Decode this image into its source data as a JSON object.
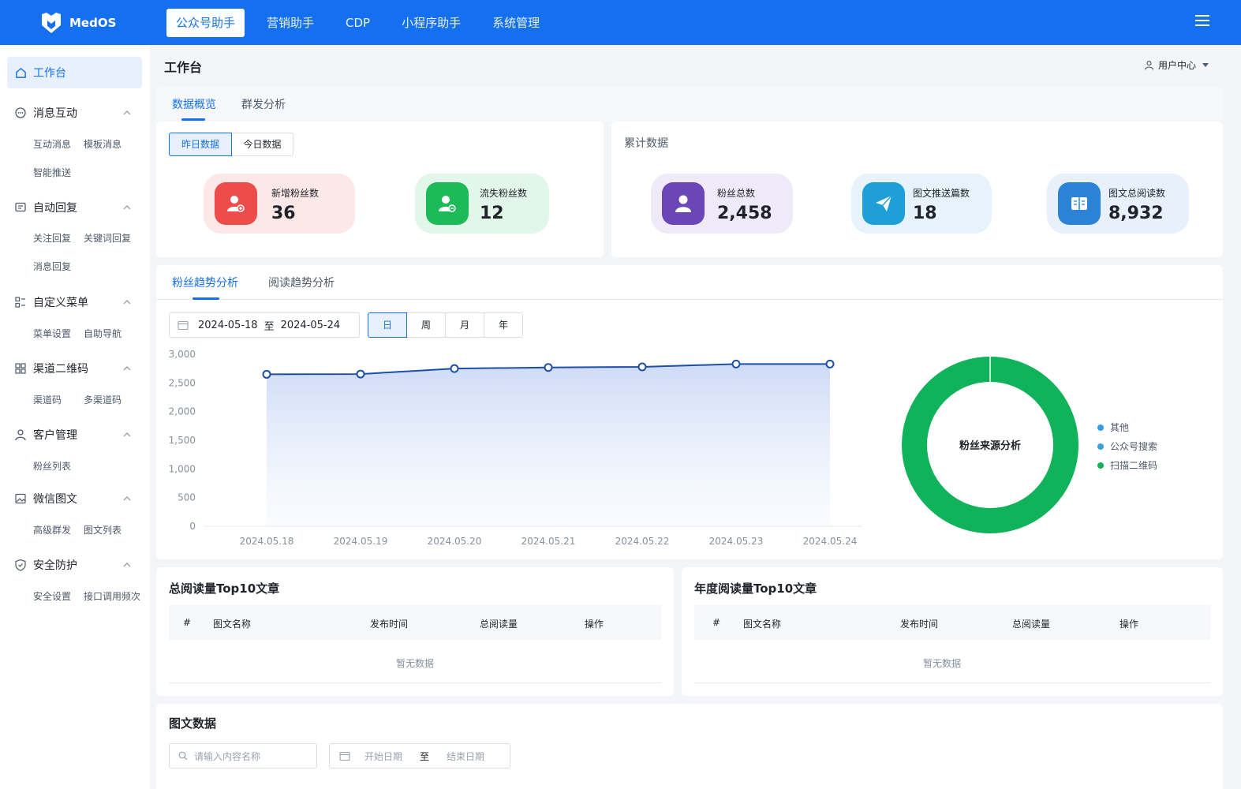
{
  "app": {
    "name": "MedOS"
  },
  "top_nav": {
    "tabs": [
      {
        "label": "公众号助手",
        "active": true
      },
      {
        "label": "营销助手",
        "active": false
      },
      {
        "label": "CDP",
        "active": false
      },
      {
        "label": "小程序助手",
        "active": false
      },
      {
        "label": "系统管理",
        "active": false
      }
    ]
  },
  "sidebar": {
    "home": "工作台",
    "groups": [
      {
        "title": "消息互动",
        "icon": "chat-icon",
        "items": [
          "互动消息",
          "模板消息",
          "智能推送"
        ]
      },
      {
        "title": "自动回复",
        "icon": "reply-icon",
        "items": [
          "关注回复",
          "关键词回复",
          "消息回复"
        ]
      },
      {
        "title": "自定义菜单",
        "icon": "menu-grid-icon",
        "items": [
          "菜单设置",
          "自助导航"
        ]
      },
      {
        "title": "渠道二维码",
        "icon": "qrcode-icon",
        "items": [
          "渠道码",
          "多渠道码"
        ]
      },
      {
        "title": "客户管理",
        "icon": "users-icon",
        "items": [
          "粉丝列表"
        ]
      },
      {
        "title": "微信图文",
        "icon": "image-icon",
        "items": [
          "高级群发",
          "图文列表"
        ]
      },
      {
        "title": "安全防护",
        "icon": "shield-icon",
        "items": [
          "安全设置",
          "接口调用频次"
        ]
      }
    ]
  },
  "header": {
    "title": "工作台",
    "user_center": "用户中心"
  },
  "overview_tabs": [
    "数据概览",
    "群发分析"
  ],
  "daily": {
    "toggle": [
      "昨日数据",
      "今日数据"
    ],
    "stats": [
      {
        "label": "新增粉丝数",
        "value": "36",
        "color": "#ee4b4b"
      },
      {
        "label": "流失粉丝数",
        "value": "12",
        "color": "#1dba5a"
      }
    ]
  },
  "cumulative": {
    "title": "累计数据",
    "stats": [
      {
        "label": "粉丝总数",
        "value": "2,458",
        "color": "#6a46b8"
      },
      {
        "label": "图文推送篇数",
        "value": "18",
        "color": "#1e9fd8"
      },
      {
        "label": "图文总阅读数",
        "value": "8,932",
        "color": "#2a83d6"
      }
    ]
  },
  "trend_tabs": [
    "粉丝趋势分析",
    "阅读趋势分析"
  ],
  "trend_filter": {
    "start": "2024-05-18",
    "to": "至",
    "end": "2024-05-24",
    "periods": [
      "日",
      "周",
      "月",
      "年"
    ]
  },
  "chart_data": [
    {
      "type": "area",
      "x": [
        "2024.05.18",
        "2024.05.19",
        "2024.05.20",
        "2024.05.21",
        "2024.05.22",
        "2024.05.23",
        "2024.05.24"
      ],
      "series": [
        {
          "values": [
            2650,
            2655,
            2750,
            2770,
            2780,
            2830,
            2830
          ]
        }
      ],
      "ylim": [
        0,
        3000
      ],
      "yticks": [
        "3,000",
        "2,500",
        "2,000",
        "1,500",
        "1,000",
        "500",
        "0"
      ],
      "ytick_values": [
        3000,
        2500,
        2000,
        1500,
        1000,
        500,
        0
      ],
      "color": "#1d4ea8",
      "grid": false
    },
    {
      "type": "pie",
      "title": "粉丝来源分析",
      "legend": "right",
      "categories": [
        "其他",
        "公众号搜索",
        "扫描二维码"
      ],
      "values": [
        0,
        0,
        100
      ],
      "colors": [
        "#2e9de6",
        "#3aa0d9",
        "#10b25a"
      ]
    }
  ],
  "tables": [
    {
      "title": "总阅读量Top10文章",
      "columns": [
        "#",
        "图文名称",
        "发布时间",
        "总阅读量",
        "操作"
      ],
      "empty": "暂无数据"
    },
    {
      "title": "年度阅读量Top10文章",
      "columns": [
        "#",
        "图文名称",
        "发布时间",
        "总阅读量",
        "操作"
      ],
      "empty": "暂无数据"
    }
  ],
  "article_data": {
    "title": "图文数据",
    "search_placeholder": "请输入内容名称",
    "start_placeholder": "开始日期",
    "to": "至",
    "end_placeholder": "结束日期"
  }
}
